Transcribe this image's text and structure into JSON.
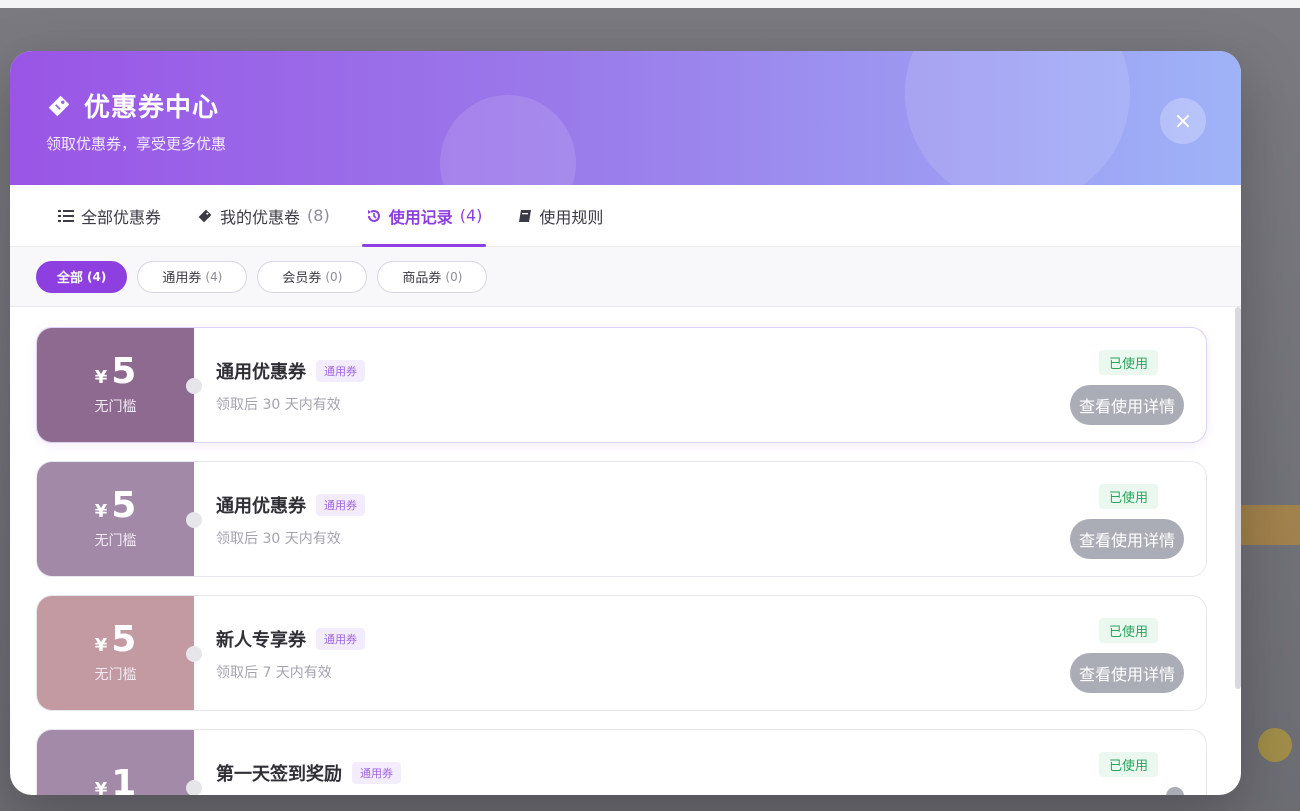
{
  "header": {
    "title": "优惠券中心",
    "subtitle": "领取优惠券，享受更多优惠",
    "close_label": "×"
  },
  "tabs": [
    {
      "label": "全部优惠券",
      "count": "",
      "icon": "list-icon",
      "active": false
    },
    {
      "label": "我的优惠卷",
      "count": "(8)",
      "icon": "ticket-icon",
      "active": false
    },
    {
      "label": "使用记录",
      "count": "(4)",
      "icon": "history-icon",
      "active": true
    },
    {
      "label": "使用规则",
      "count": "",
      "icon": "book-icon",
      "active": false
    }
  ],
  "filters": [
    {
      "label": "全部",
      "count": "(4)",
      "active": true
    },
    {
      "label": "通用券",
      "count": "(4)",
      "active": false
    },
    {
      "label": "会员券",
      "count": "(0)",
      "active": false
    },
    {
      "label": "商品券",
      "count": "(0)",
      "active": false
    }
  ],
  "coupons": [
    {
      "currency": "¥",
      "amount": "5",
      "condition": "无门槛",
      "name": "通用优惠券",
      "tag": "通用券",
      "validity": "领取后 30 天内有效",
      "status": "已使用",
      "action": "查看使用详情",
      "color": "#8e6a90"
    },
    {
      "currency": "¥",
      "amount": "5",
      "condition": "无门槛",
      "name": "通用优惠券",
      "tag": "通用券",
      "validity": "领取后 30 天内有效",
      "status": "已使用",
      "action": "查看使用详情",
      "color": "#a389a8"
    },
    {
      "currency": "¥",
      "amount": "5",
      "condition": "无门槛",
      "name": "新人专享券",
      "tag": "通用券",
      "validity": "领取后 7 天内有效",
      "status": "已使用",
      "action": "查看使用详情",
      "color": "#c39aa2"
    },
    {
      "currency": "¥",
      "amount": "1",
      "condition": "",
      "name": "第一天签到奖励",
      "tag": "通用券",
      "validity": "",
      "status": "已使用",
      "action": "",
      "color": "#a48aa9"
    }
  ],
  "colors": {
    "accent": "#8e3fe0",
    "used": "#27a55a"
  }
}
